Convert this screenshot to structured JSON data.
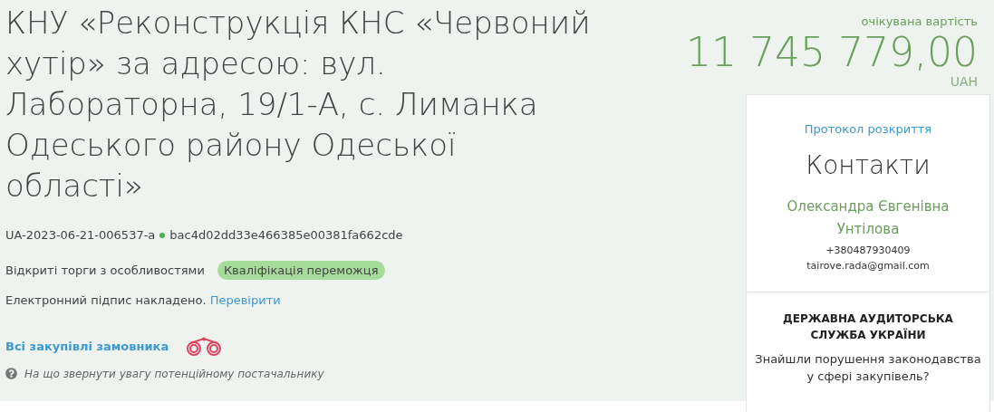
{
  "title": "КНУ «Реконструкція КНС «Червоний хутір» за адресою: вул. Лабораторна, 19/1-А, с. Лиманка Одеського району Одеської області»",
  "tender_id": "UA-2023-06-21-006537-a",
  "hash": "bac4d02dd33e466385e00381fa662cde",
  "procedure_type": "Відкриті торги з особливостями",
  "status": {
    "label": "Кваліфікація переможця",
    "color": "#a6dc9a"
  },
  "signature": {
    "text": "Електронний підпис накладено.",
    "link": "Перевірити"
  },
  "customer_link": "Всі закупівлі замовника",
  "hint": "На що звернути увагу потенційному постачальнику",
  "expected_value": {
    "label": "очікувана вартість",
    "amount": "11 745 779,00",
    "currency": "UAH"
  },
  "card": {
    "protocol_link": "Протокол розкриття",
    "contacts_title": "Контакти",
    "contact_name": "Олександра Євгенівна Унтілова",
    "phone": "+380487930409",
    "email": "tairove.rada@gmail.com",
    "audit_heading": "ДЕРЖАВНА АУДИТОРСЬКА СЛУЖБА УКРАЇНИ",
    "audit_text": "Знайшли порушення законодавства у сфері закупівель?"
  }
}
